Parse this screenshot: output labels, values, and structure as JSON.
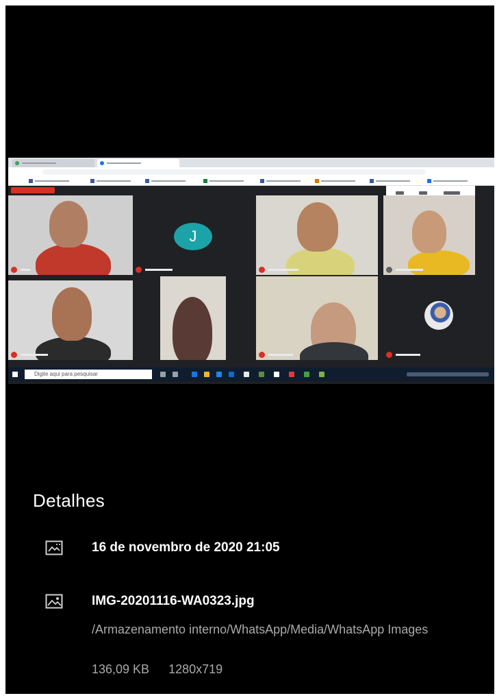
{
  "screenshot": {
    "meet": {
      "avatar_letter": "J"
    },
    "taskbar": {
      "search_placeholder": "Digite aqui para pesquisar"
    }
  },
  "details": {
    "title": "Detalhes",
    "date_icon": "calendar-image-icon",
    "date": "16 de novembro de 2020 21:05",
    "file_icon": "image-file-icon",
    "filename": "IMG-20201116-WA0323.jpg",
    "path": "/Armazenamento interno/WhatsApp/Media/WhatsApp Images",
    "size": "136,09 KB",
    "resolution": "1280x719"
  },
  "colors": {
    "background": "#000000",
    "primary_text": "#ffffff",
    "secondary_text": "#a9a9a9",
    "meet_background": "#202124",
    "avatar": "#1ba3a8"
  }
}
